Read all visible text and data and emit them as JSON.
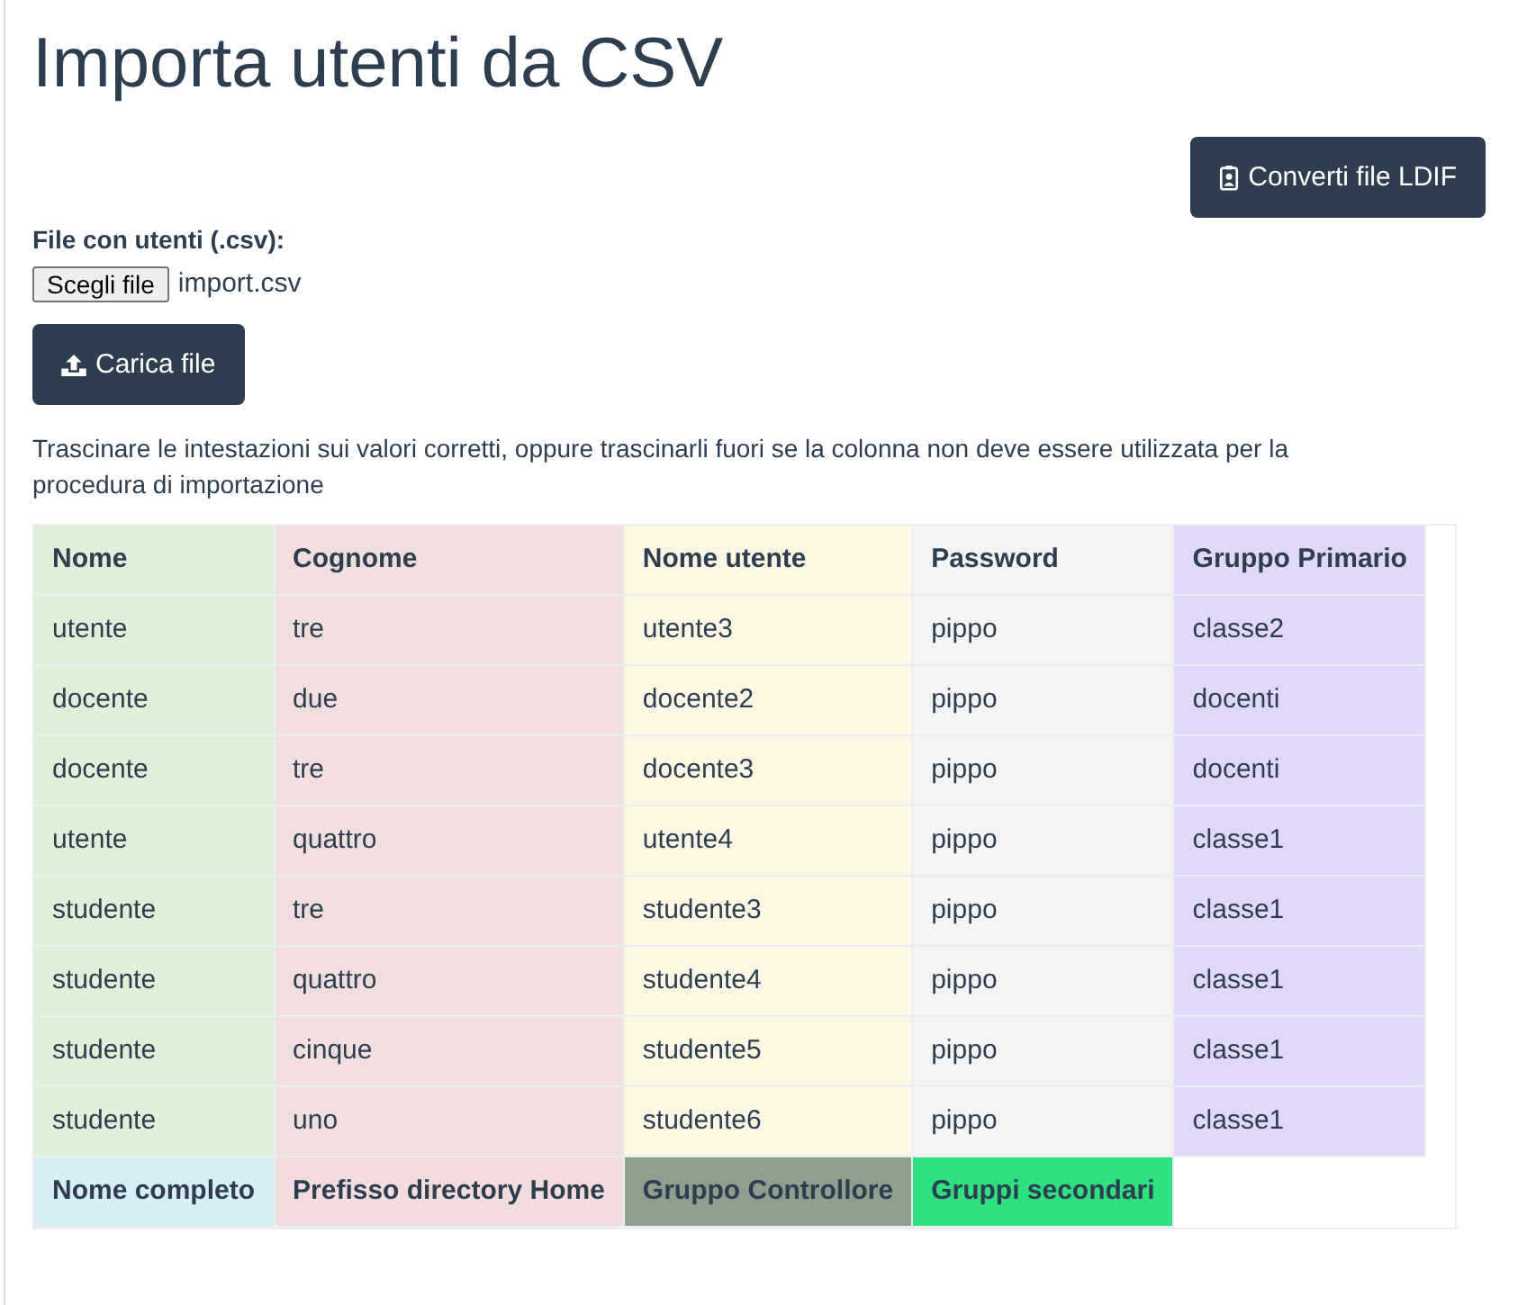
{
  "page": {
    "title": "Importa utenti da CSV"
  },
  "convert_button": {
    "label": "Converti file LDIF"
  },
  "file_field": {
    "label": "File con utenti (.csv):",
    "button": "Scegli file",
    "value": "import.csv"
  },
  "upload_button": {
    "label": "Carica file"
  },
  "instructions": "Trascinare le intestazioni sui valori corretti, oppure trascinarli fuori se la colonna non deve essere utilizzata per la procedura di importazione",
  "table": {
    "columns": [
      {
        "label": "Nome",
        "color": "#dff0d8"
      },
      {
        "label": "Cognome",
        "color": "#f2dede"
      },
      {
        "label": "Nome utente",
        "color": "#fcf8e3"
      },
      {
        "label": "Password",
        "color": "#f4f4f4"
      },
      {
        "label": "Gruppo Primario",
        "color": "#e1d8f7"
      }
    ],
    "rows": [
      [
        "utente",
        "tre",
        "utente3",
        "pippo",
        "classe2"
      ],
      [
        "docente",
        "due",
        "docente2",
        "pippo",
        "docenti"
      ],
      [
        "docente",
        "tre",
        "docente3",
        "pippo",
        "docenti"
      ],
      [
        "utente",
        "quattro",
        "utente4",
        "pippo",
        "classe1"
      ],
      [
        "studente",
        "tre",
        "studente3",
        "pippo",
        "classe1"
      ],
      [
        "studente",
        "quattro",
        "studente4",
        "pippo",
        "classe1"
      ],
      [
        "studente",
        "cinque",
        "studente5",
        "pippo",
        "classe1"
      ],
      [
        "studente",
        "uno",
        "studente6",
        "pippo",
        "classe1"
      ]
    ],
    "unassigned_headers": [
      {
        "label": "Nome completo",
        "color": "#d9edf7"
      },
      {
        "label": "Prefisso directory Home",
        "color": "#f4dcde"
      },
      {
        "label": "Gruppo Controllore",
        "color": "#8d9f8d"
      },
      {
        "label": "Gruppi secondari",
        "color": "#2fe080"
      }
    ]
  }
}
